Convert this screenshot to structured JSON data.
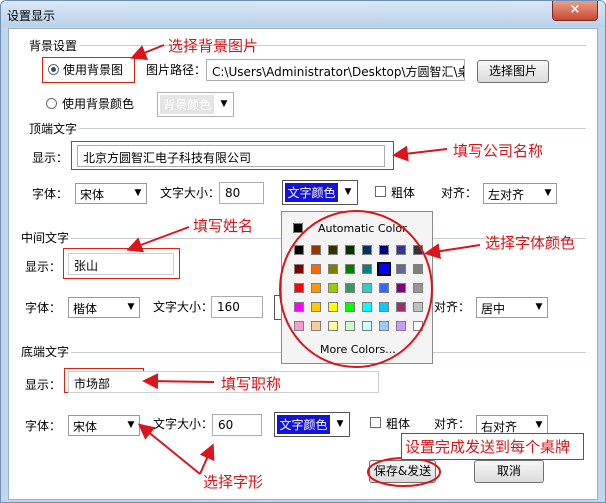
{
  "window": {
    "title": "设置显示",
    "close_label": "×"
  },
  "background": {
    "group_label": "背景设置",
    "use_image_label": "使用背景图",
    "path_label": "图片路径：",
    "path_value": "C:\\Users\\Administrator\\Desktop\\方圆智汇\\桌牌后台",
    "choose_image_button": "选择图片",
    "use_color_label": "使用背景颜色",
    "color_button": "背景颜色"
  },
  "top": {
    "group_label": "顶端文字",
    "display_label": "显示：",
    "display_value": "北京方圆智汇电子科技有限公司",
    "font_label": "字体：",
    "font_value": "宋体",
    "size_label": "文字大小：",
    "size_value": "80",
    "color_button": "文字颜色",
    "bold_label": "粗体",
    "align_label": "对齐：",
    "align_value": "左对齐"
  },
  "middle": {
    "group_label": "中间文字",
    "display_label": "显示：",
    "display_value": "张山",
    "font_label": "字体：",
    "font_value": "楷体",
    "size_label": "文字大小：",
    "size_value": "160",
    "align_label": "对齐：",
    "align_value": "居中"
  },
  "bottom": {
    "group_label": "底端文字",
    "display_label": "显示：",
    "display_value": "市场部",
    "font_label": "字体：",
    "font_value": "宋体",
    "size_label": "文字大小：",
    "size_value": "60",
    "color_button": "文字颜色",
    "bold_label": "粗体",
    "align_label": "对齐：",
    "align_value": "右对齐"
  },
  "actions": {
    "save_send": "保存&发送",
    "cancel": "取消"
  },
  "color_popup": {
    "automatic": "Automatic Color",
    "more": "More Colors...",
    "rows": [
      [
        "#000000",
        "#993300",
        "#333300",
        "#003300",
        "#003366",
        "#000080",
        "#333399",
        "#333333"
      ],
      [
        "#800000",
        "#ff6600",
        "#808000",
        "#008000",
        "#008080",
        "#0000ff",
        "#666699",
        "#808080"
      ],
      [
        "#ff0000",
        "#ff9900",
        "#99cc00",
        "#339966",
        "#33cccc",
        "#3366ff",
        "#800080",
        "#969696"
      ],
      [
        "#ff00ff",
        "#ffcc00",
        "#ffff00",
        "#00ff00",
        "#00ffff",
        "#00ccff",
        "#993366",
        "#c0c0c0"
      ],
      [
        "#ff99cc",
        "#ffcc99",
        "#ffff99",
        "#ccffcc",
        "#ccffff",
        "#99ccff",
        "#cc99ff",
        "#ffffff"
      ]
    ]
  },
  "annotations": {
    "choose_bg_image": "选择背景图片",
    "fill_company": "填写公司名称",
    "fill_name": "填写姓名",
    "choose_font_color": "选择字体颜色",
    "fill_title": "填写职称",
    "choose_font": "选择字形",
    "save_send_note": "设置完成发送到每个桌牌"
  },
  "colors": {
    "accent_red": "#d8161b",
    "color_button_blue": "#1414d8"
  }
}
